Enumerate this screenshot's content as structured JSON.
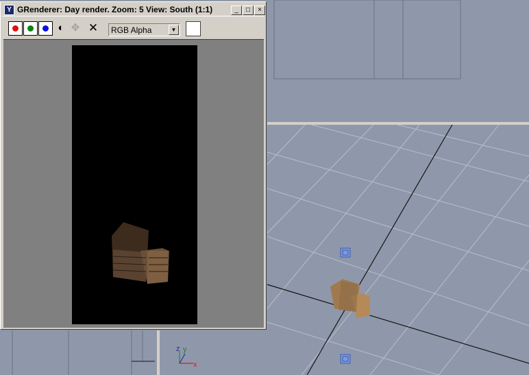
{
  "window": {
    "title": "GRenderer: Day render. Zoom: 5 View: South (1:1)",
    "title_icon": "Y",
    "controls": {
      "minimize": "_",
      "maximize": "□",
      "close": "×"
    }
  },
  "toolbar": {
    "channels": [
      {
        "name": "red",
        "color": "#e01010"
      },
      {
        "name": "green",
        "color": "#108010"
      },
      {
        "name": "blue",
        "color": "#1010e0"
      }
    ],
    "mono_icon": "◐",
    "disabled_icon": "✥",
    "clear_icon": "✕",
    "display_mode": "RGB Alpha",
    "display_arrow": "▼"
  },
  "viewport": {
    "axis_labels": {
      "x": "x",
      "y": "y",
      "z": "z"
    }
  }
}
